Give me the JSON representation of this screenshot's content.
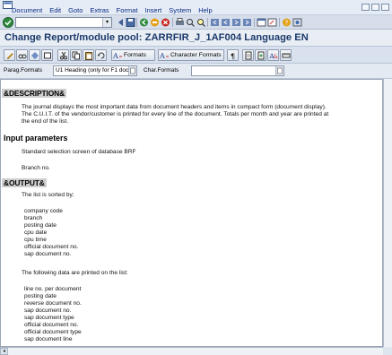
{
  "menubar": {
    "items": [
      "Document",
      "Edit",
      "Goto",
      "Extras",
      "Format",
      "Insert",
      "System",
      "Help"
    ]
  },
  "toolbar": {
    "command_value": ""
  },
  "header": {
    "title": "Change Report/module pool: ZARRFIR_J_1AF004 Language EN"
  },
  "apptoolbar": {
    "formats_label": "Formats",
    "character_formats_label": "Character Formats"
  },
  "formatline": {
    "paragraph_label": "Parag.Formats",
    "paragraph_value": "U1 Heading (only for F1 doc.!)",
    "character_label": "Char.Formats",
    "character_value": ""
  },
  "document": {
    "description_heading": "&DESCRIPTION&",
    "description_lines": [
      "The journal displays the most important data from document headers and items in compact form (document display).",
      "The C.U.I.T. of the vendor/customer is printed for every line of the document. Totals per month and year are printed at",
      "the end of the list."
    ],
    "input_heading": "Input parameters",
    "input_line_1": "Standard selection screen of database BRF",
    "input_line_2": "Branch no.",
    "output_heading": "&OUTPUT&",
    "sorted_by": "The list is sorted by;",
    "sort_fields": [
      "company code",
      "branch",
      "posting date",
      "cpu date",
      "cpu time",
      "official document no.",
      "sap document no."
    ],
    "printed_intro": "The following data are printed on the list:",
    "printed_fields": [
      "line no. per document",
      "posting date",
      "reverse document no.",
      "sap document no.",
      "sap document type",
      "official document no.",
      "official document type",
      "sap document line"
    ]
  },
  "colors": {
    "title": "#1c3a6b",
    "menu_text": "#0b2c88",
    "heading_bg": "#cfcfcf"
  }
}
